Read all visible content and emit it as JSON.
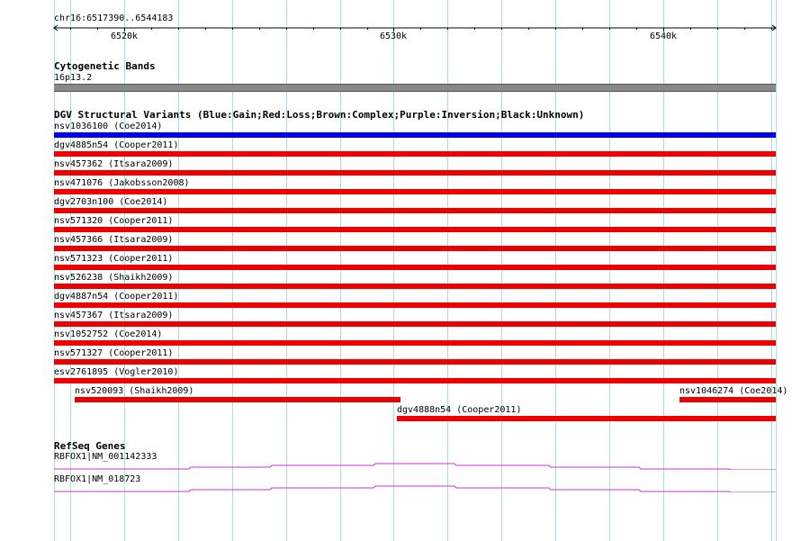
{
  "region": {
    "chrom_label": "chr16:6517390..6544183",
    "start": 6517390,
    "end": 6544183
  },
  "ruler": {
    "ticks": [
      {
        "pos": 6520000,
        "label": "6520k"
      },
      {
        "pos": 6530000,
        "label": "6530k"
      },
      {
        "pos": 6540000,
        "label": "6540k"
      }
    ]
  },
  "tracks": {
    "cytoband": {
      "title": "Cytogenetic Bands",
      "band_label": "16p13.2",
      "color": "#888888"
    },
    "dgv": {
      "title": "DGV Structural Variants (Blue:Gain;Red:Loss;Brown:Complex;Purple:Inversion;Black:Unknown)",
      "colors": {
        "gain": "#0000ee",
        "loss": "#ee0000"
      },
      "variants": [
        {
          "label": "nsv1036100 (Coe2014)",
          "type": "gain",
          "start": 6517390,
          "end": 6544183
        },
        {
          "label": "dgv4885n54 (Cooper2011)",
          "type": "loss",
          "start": 6517390,
          "end": 6544183
        },
        {
          "label": "nsv457362 (Itsara2009)",
          "type": "loss",
          "start": 6517390,
          "end": 6544183
        },
        {
          "label": "nsv471076 (Jakobsson2008)",
          "type": "loss",
          "start": 6517390,
          "end": 6544183
        },
        {
          "label": "dgv2703n100 (Coe2014)",
          "type": "loss",
          "start": 6517390,
          "end": 6544183
        },
        {
          "label": "nsv571320 (Cooper2011)",
          "type": "loss",
          "start": 6517390,
          "end": 6544183
        },
        {
          "label": "nsv457366 (Itsara2009)",
          "type": "loss",
          "start": 6517390,
          "end": 6544183
        },
        {
          "label": "nsv571323 (Cooper2011)",
          "type": "loss",
          "start": 6517390,
          "end": 6544183
        },
        {
          "label": "nsv526238 (Shaikh2009)",
          "type": "loss",
          "start": 6517390,
          "end": 6544183
        },
        {
          "label": "dgv4887n54 (Cooper2011)",
          "type": "loss",
          "start": 6517390,
          "end": 6544183
        },
        {
          "label": "nsv457367 (Itsara2009)",
          "type": "loss",
          "start": 6517390,
          "end": 6544183
        },
        {
          "label": "nsv1052752 (Coe2014)",
          "type": "loss",
          "start": 6517390,
          "end": 6544183
        },
        {
          "label": "nsv571327 (Cooper2011)",
          "type": "loss",
          "start": 6517390,
          "end": 6544183
        },
        {
          "label": "esv2761895 (Vogler2010)",
          "type": "loss",
          "start": 6517390,
          "end": 6544183
        },
        {
          "label": "nsv520093 (Shaikh2009)",
          "type": "loss",
          "start": 6518150,
          "end": 6530240
        },
        {
          "label": "nsv1046274 (Coe2014)",
          "type": "loss",
          "start": 6540610,
          "end": 6544183
        },
        {
          "label": "dgv4888n54 (Cooper2011)",
          "type": "loss",
          "start": 6530120,
          "end": 6544183
        }
      ]
    },
    "refseq": {
      "title": "RefSeq Genes",
      "color": "#cc33cc",
      "genes": [
        {
          "label": "RBFOX1|NM_001142333"
        },
        {
          "label": "RBFOX1|NM_018723"
        }
      ]
    }
  }
}
